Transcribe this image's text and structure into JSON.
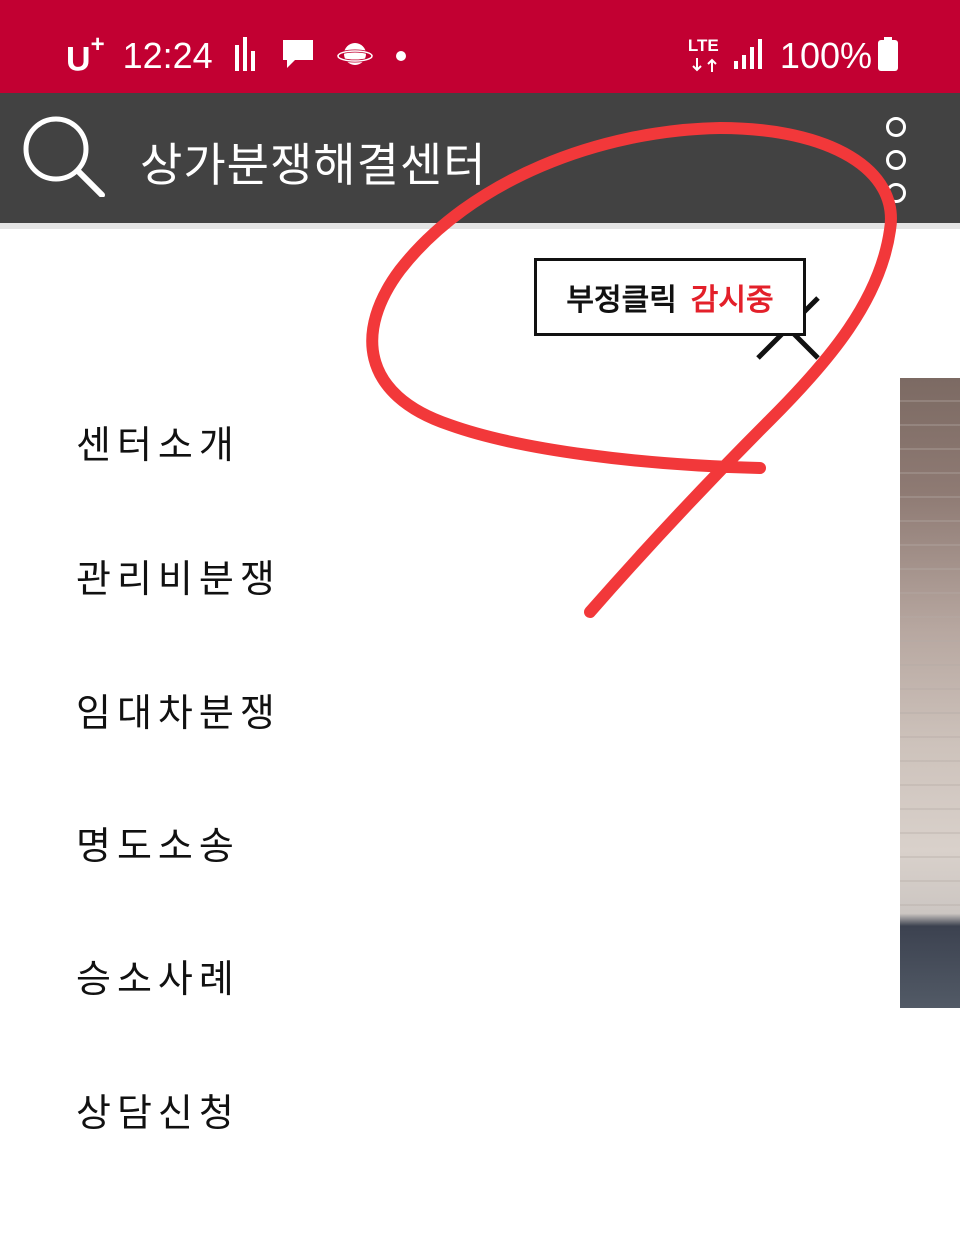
{
  "status_bar": {
    "carrier": "U",
    "carrier_plus": "+",
    "time": "12:24",
    "network": "LTE",
    "battery": "100%",
    "icons": [
      "signal-bars-icon",
      "chat-icon",
      "planet-icon",
      "notification-dot-icon",
      "lte-icon",
      "cell-signal-icon",
      "battery-icon"
    ]
  },
  "toolbar": {
    "title": "상가분쟁해결센터",
    "search_icon": "search-icon",
    "more_icon": "more-vert-icon"
  },
  "menu": {
    "items": [
      {
        "label": "센터소개"
      },
      {
        "label": "관리비분쟁"
      },
      {
        "label": "임대차분쟁"
      },
      {
        "label": "명도소송"
      },
      {
        "label": "승소사례"
      },
      {
        "label": "상담신청"
      }
    ]
  },
  "ad_badge": {
    "text_black": "부정클릭",
    "text_red": "감시중",
    "close_icon": "close-icon"
  },
  "colors": {
    "status_bar": "#c20032",
    "toolbar": "#424242",
    "scribble": "#f2383a",
    "badge_red": "#e3202a"
  }
}
